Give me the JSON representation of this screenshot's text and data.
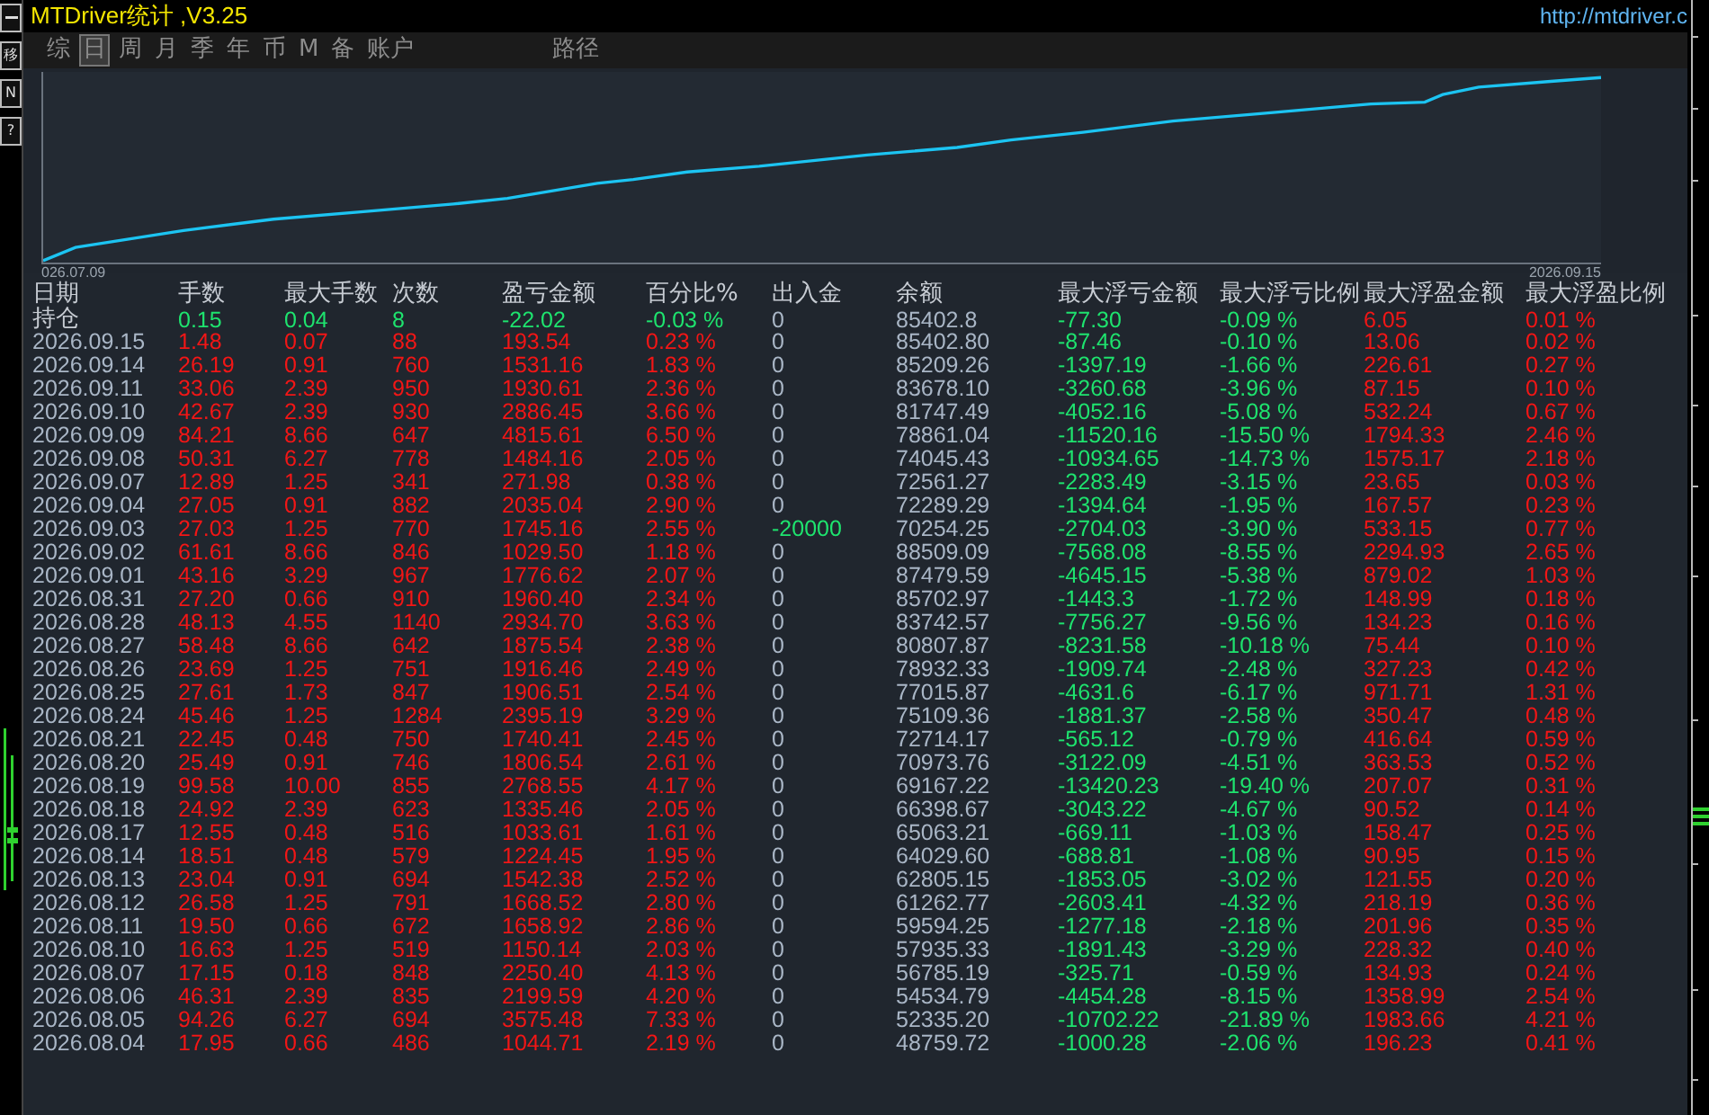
{
  "window": {
    "title": "MTDriver统计 ,V3.25",
    "link": "http://mtdriver.c"
  },
  "side_tools": [
    {
      "kind": "icon"
    },
    {
      "kind": "text",
      "label": "移"
    },
    {
      "kind": "text",
      "label": "N"
    },
    {
      "kind": "text",
      "label": "?"
    }
  ],
  "tabs": [
    {
      "label": "综",
      "selected": false
    },
    {
      "label": "日",
      "selected": true
    },
    {
      "label": "周",
      "selected": false
    },
    {
      "label": "月",
      "selected": false
    },
    {
      "label": "季",
      "selected": false
    },
    {
      "label": "年",
      "selected": false
    },
    {
      "label": "币",
      "selected": false
    },
    {
      "label": "M",
      "selected": false
    },
    {
      "label": "备",
      "selected": false
    },
    {
      "label": "账户",
      "selected": false
    },
    {
      "label": "路径",
      "selected": false
    }
  ],
  "chart": {
    "start_label": "026.07.09",
    "end_label": "2026.09.15"
  },
  "table": {
    "columns": [
      {
        "label": "日期",
        "kind": "neutral"
      },
      {
        "label": "手数",
        "kind": "trend"
      },
      {
        "label": "最大手数",
        "kind": "trend"
      },
      {
        "label": "次数",
        "kind": "trend"
      },
      {
        "label": "盈亏金额",
        "kind": "trend"
      },
      {
        "label": "百分比%",
        "kind": "trend"
      },
      {
        "label": "出入金",
        "kind": "flow"
      },
      {
        "label": "余额",
        "kind": "neutral"
      },
      {
        "label": "最大浮亏金额",
        "kind": "loss"
      },
      {
        "label": "最大浮亏比例",
        "kind": "loss"
      },
      {
        "label": "最大浮盈金额",
        "kind": "gain"
      },
      {
        "label": "最大浮盈比例",
        "kind": "gain"
      }
    ],
    "rows": [
      {
        "date": "持仓",
        "kind": "summary",
        "loss": true,
        "withdrawal": false,
        "values": [
          "0.15",
          "0.04",
          "8",
          "-22.02",
          "-0.03 %",
          "0",
          "85402.8",
          "-77.30",
          "-0.09 %",
          "6.05",
          "0.01 %"
        ]
      },
      {
        "date": "2026.09.15",
        "kind": "day",
        "loss": false,
        "withdrawal": false,
        "values": [
          "1.48",
          "0.07",
          "88",
          "193.54",
          "0.23 %",
          "0",
          "85402.80",
          "-87.46",
          "-0.10 %",
          "13.06",
          "0.02 %"
        ]
      },
      {
        "date": "2026.09.14",
        "kind": "day",
        "loss": false,
        "withdrawal": false,
        "values": [
          "26.19",
          "0.91",
          "760",
          "1531.16",
          "1.83 %",
          "0",
          "85209.26",
          "-1397.19",
          "-1.66 %",
          "226.61",
          "0.27 %"
        ]
      },
      {
        "date": "2026.09.11",
        "kind": "day",
        "loss": false,
        "withdrawal": false,
        "values": [
          "33.06",
          "2.39",
          "950",
          "1930.61",
          "2.36 %",
          "0",
          "83678.10",
          "-3260.68",
          "-3.96 %",
          "87.15",
          "0.10 %"
        ]
      },
      {
        "date": "2026.09.10",
        "kind": "day",
        "loss": false,
        "withdrawal": false,
        "values": [
          "42.67",
          "2.39",
          "930",
          "2886.45",
          "3.66 %",
          "0",
          "81747.49",
          "-4052.16",
          "-5.08 %",
          "532.24",
          "0.67 %"
        ]
      },
      {
        "date": "2026.09.09",
        "kind": "day",
        "loss": false,
        "withdrawal": false,
        "values": [
          "84.21",
          "8.66",
          "647",
          "4815.61",
          "6.50 %",
          "0",
          "78861.04",
          "-11520.16",
          "-15.50 %",
          "1794.33",
          "2.46 %"
        ]
      },
      {
        "date": "2026.09.08",
        "kind": "day",
        "loss": false,
        "withdrawal": false,
        "values": [
          "50.31",
          "6.27",
          "778",
          "1484.16",
          "2.05 %",
          "0",
          "74045.43",
          "-10934.65",
          "-14.73 %",
          "1575.17",
          "2.18 %"
        ]
      },
      {
        "date": "2026.09.07",
        "kind": "day",
        "loss": false,
        "withdrawal": false,
        "values": [
          "12.89",
          "1.25",
          "341",
          "271.98",
          "0.38 %",
          "0",
          "72561.27",
          "-2283.49",
          "-3.15 %",
          "23.65",
          "0.03 %"
        ]
      },
      {
        "date": "2026.09.04",
        "kind": "day",
        "loss": false,
        "withdrawal": false,
        "values": [
          "27.05",
          "0.91",
          "882",
          "2035.04",
          "2.90 %",
          "0",
          "72289.29",
          "-1394.64",
          "-1.95 %",
          "167.57",
          "0.23 %"
        ]
      },
      {
        "date": "2026.09.03",
        "kind": "day",
        "loss": false,
        "withdrawal": true,
        "values": [
          "27.03",
          "1.25",
          "770",
          "1745.16",
          "2.55 %",
          "-20000",
          "70254.25",
          "-2704.03",
          "-3.90 %",
          "533.15",
          "0.77 %"
        ]
      },
      {
        "date": "2026.09.02",
        "kind": "day",
        "loss": false,
        "withdrawal": false,
        "values": [
          "61.61",
          "8.66",
          "846",
          "1029.50",
          "1.18 %",
          "0",
          "88509.09",
          "-7568.08",
          "-8.55 %",
          "2294.93",
          "2.65 %"
        ]
      },
      {
        "date": "2026.09.01",
        "kind": "day",
        "loss": false,
        "withdrawal": false,
        "values": [
          "43.16",
          "3.29",
          "967",
          "1776.62",
          "2.07 %",
          "0",
          "87479.59",
          "-4645.15",
          "-5.38 %",
          "879.02",
          "1.03 %"
        ]
      },
      {
        "date": "2026.08.31",
        "kind": "day",
        "loss": false,
        "withdrawal": false,
        "values": [
          "27.20",
          "0.66",
          "910",
          "1960.40",
          "2.34 %",
          "0",
          "85702.97",
          "-1443.3",
          "-1.72 %",
          "148.99",
          "0.18 %"
        ]
      },
      {
        "date": "2026.08.28",
        "kind": "day",
        "loss": false,
        "withdrawal": false,
        "values": [
          "48.13",
          "4.55",
          "1140",
          "2934.70",
          "3.63 %",
          "0",
          "83742.57",
          "-7756.27",
          "-9.56 %",
          "134.23",
          "0.16 %"
        ]
      },
      {
        "date": "2026.08.27",
        "kind": "day",
        "loss": false,
        "withdrawal": false,
        "values": [
          "58.48",
          "8.66",
          "642",
          "1875.54",
          "2.38 %",
          "0",
          "80807.87",
          "-8231.58",
          "-10.18 %",
          "75.44",
          "0.10 %"
        ]
      },
      {
        "date": "2026.08.26",
        "kind": "day",
        "loss": false,
        "withdrawal": false,
        "values": [
          "23.69",
          "1.25",
          "751",
          "1916.46",
          "2.49 %",
          "0",
          "78932.33",
          "-1909.74",
          "-2.48 %",
          "327.23",
          "0.42 %"
        ]
      },
      {
        "date": "2026.08.25",
        "kind": "day",
        "loss": false,
        "withdrawal": false,
        "values": [
          "27.61",
          "1.73",
          "847",
          "1906.51",
          "2.54 %",
          "0",
          "77015.87",
          "-4631.6",
          "-6.17 %",
          "971.71",
          "1.31 %"
        ]
      },
      {
        "date": "2026.08.24",
        "kind": "day",
        "loss": false,
        "withdrawal": false,
        "values": [
          "45.46",
          "1.25",
          "1284",
          "2395.19",
          "3.29 %",
          "0",
          "75109.36",
          "-1881.37",
          "-2.58 %",
          "350.47",
          "0.48 %"
        ]
      },
      {
        "date": "2026.08.21",
        "kind": "day",
        "loss": false,
        "withdrawal": false,
        "values": [
          "22.45",
          "0.48",
          "750",
          "1740.41",
          "2.45 %",
          "0",
          "72714.17",
          "-565.12",
          "-0.79 %",
          "416.64",
          "0.59 %"
        ]
      },
      {
        "date": "2026.08.20",
        "kind": "day",
        "loss": false,
        "withdrawal": false,
        "values": [
          "25.49",
          "0.91",
          "746",
          "1806.54",
          "2.61 %",
          "0",
          "70973.76",
          "-3122.09",
          "-4.51 %",
          "363.53",
          "0.52 %"
        ]
      },
      {
        "date": "2026.08.19",
        "kind": "day",
        "loss": false,
        "withdrawal": false,
        "values": [
          "99.58",
          "10.00",
          "855",
          "2768.55",
          "4.17 %",
          "0",
          "69167.22",
          "-13420.23",
          "-19.40 %",
          "207.07",
          "0.31 %"
        ]
      },
      {
        "date": "2026.08.18",
        "kind": "day",
        "loss": false,
        "withdrawal": false,
        "values": [
          "24.92",
          "2.39",
          "623",
          "1335.46",
          "2.05 %",
          "0",
          "66398.67",
          "-3043.22",
          "-4.67 %",
          "90.52",
          "0.14 %"
        ]
      },
      {
        "date": "2026.08.17",
        "kind": "day",
        "loss": false,
        "withdrawal": false,
        "values": [
          "12.55",
          "0.48",
          "516",
          "1033.61",
          "1.61 %",
          "0",
          "65063.21",
          "-669.11",
          "-1.03 %",
          "158.47",
          "0.25 %"
        ]
      },
      {
        "date": "2026.08.14",
        "kind": "day",
        "loss": false,
        "withdrawal": false,
        "values": [
          "18.51",
          "0.48",
          "579",
          "1224.45",
          "1.95 %",
          "0",
          "64029.60",
          "-688.81",
          "-1.08 %",
          "90.95",
          "0.15 %"
        ]
      },
      {
        "date": "2026.08.13",
        "kind": "day",
        "loss": false,
        "withdrawal": false,
        "values": [
          "23.04",
          "0.91",
          "694",
          "1542.38",
          "2.52 %",
          "0",
          "62805.15",
          "-1853.05",
          "-3.02 %",
          "121.55",
          "0.20 %"
        ]
      },
      {
        "date": "2026.08.12",
        "kind": "day",
        "loss": false,
        "withdrawal": false,
        "values": [
          "26.58",
          "1.25",
          "791",
          "1668.52",
          "2.80 %",
          "0",
          "61262.77",
          "-2603.41",
          "-4.32 %",
          "218.19",
          "0.36 %"
        ]
      },
      {
        "date": "2026.08.11",
        "kind": "day",
        "loss": false,
        "withdrawal": false,
        "values": [
          "19.50",
          "0.66",
          "672",
          "1658.92",
          "2.86 %",
          "0",
          "59594.25",
          "-1277.18",
          "-2.18 %",
          "201.96",
          "0.35 %"
        ]
      },
      {
        "date": "2026.08.10",
        "kind": "day",
        "loss": false,
        "withdrawal": false,
        "values": [
          "16.63",
          "1.25",
          "519",
          "1150.14",
          "2.03 %",
          "0",
          "57935.33",
          "-1891.43",
          "-3.29 %",
          "228.32",
          "0.40 %"
        ]
      },
      {
        "date": "2026.08.07",
        "kind": "day",
        "loss": false,
        "withdrawal": false,
        "values": [
          "17.15",
          "0.18",
          "848",
          "2250.40",
          "4.13 %",
          "0",
          "56785.19",
          "-325.71",
          "-0.59 %",
          "134.93",
          "0.24 %"
        ]
      },
      {
        "date": "2026.08.06",
        "kind": "day",
        "loss": false,
        "withdrawal": false,
        "values": [
          "46.31",
          "2.39",
          "835",
          "2199.59",
          "4.20 %",
          "0",
          "54534.79",
          "-4454.28",
          "-8.15 %",
          "1358.99",
          "2.54 %"
        ]
      },
      {
        "date": "2026.08.05",
        "kind": "day",
        "loss": false,
        "withdrawal": false,
        "values": [
          "94.26",
          "6.27",
          "694",
          "3575.48",
          "7.33 %",
          "0",
          "52335.20",
          "-10702.22",
          "-21.89 %",
          "1983.66",
          "4.21 %"
        ]
      },
      {
        "date": "2026.08.04",
        "kind": "day",
        "loss": false,
        "withdrawal": false,
        "values": [
          "17.95",
          "0.66",
          "486",
          "1044.71",
          "2.19 %",
          "0",
          "48759.72",
          "-1000.28",
          "-2.06 %",
          "196.23",
          "0.41 %"
        ]
      }
    ]
  }
}
